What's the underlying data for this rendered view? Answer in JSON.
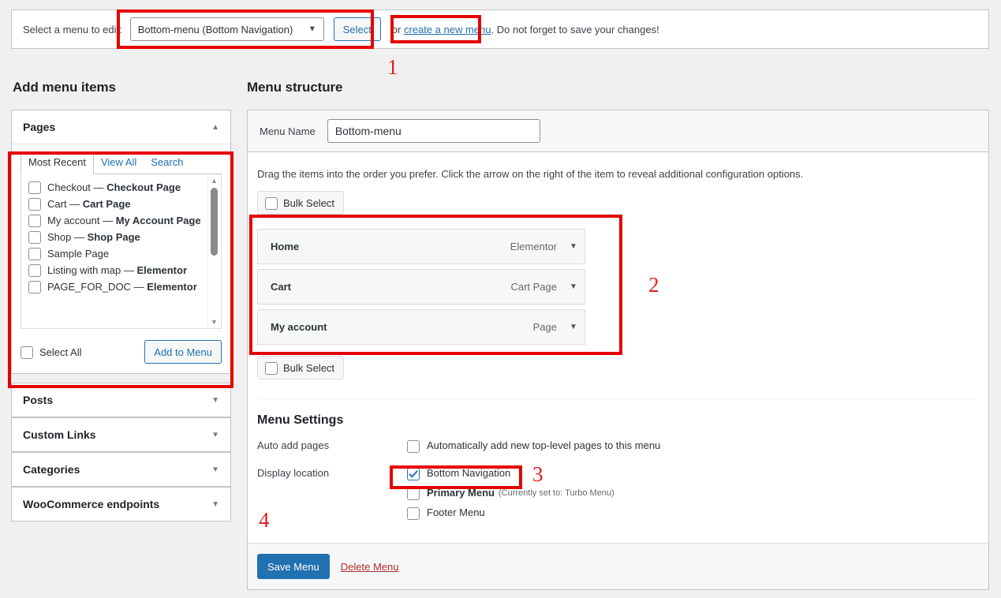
{
  "topbar": {
    "label": "Select a menu to edit:",
    "selected_menu": "Bottom-menu (Bottom Navigation)",
    "select_button": "Select",
    "or_text": "or",
    "create_link": "create a new menu",
    "tail_text": ". Do not forget to save your changes!"
  },
  "left": {
    "heading": "Add menu items",
    "pages_panel": {
      "title": "Pages",
      "tabs": [
        {
          "label": "Most Recent",
          "active": true
        },
        {
          "label": "View All",
          "active": false
        },
        {
          "label": "Search",
          "active": false
        }
      ],
      "rows": [
        {
          "kind": "check",
          "plain": "Checkout — ",
          "bold": "Checkout Page"
        },
        {
          "kind": "check",
          "plain": "Cart — ",
          "bold": "Cart Page"
        },
        {
          "kind": "check",
          "plain": "My account — ",
          "bold": "My Account Page"
        },
        {
          "kind": "check",
          "plain": "Shop — ",
          "bold": "Shop Page"
        },
        {
          "kind": "check",
          "plain": "Sample Page",
          "bold": ""
        },
        {
          "kind": "check",
          "plain": "Listing with map — ",
          "bold": "Elementor"
        },
        {
          "kind": "check",
          "plain": "PAGE_FOR_DOC — ",
          "bold": "Elementor"
        }
      ],
      "select_all": "Select All",
      "add_button": "Add to Menu"
    },
    "other_panels": [
      {
        "title": "Posts"
      },
      {
        "title": "Custom Links"
      },
      {
        "title": "Categories"
      },
      {
        "title": "WooCommerce endpoints"
      }
    ]
  },
  "right": {
    "heading": "Menu structure",
    "menu_name_label": "Menu Name",
    "menu_name_value": "Bottom-menu",
    "menu_name_placeholder": "Menu Name",
    "hint": "Drag the items into the order you prefer. Click the arrow on the right of the item to reveal additional configuration options.",
    "bulk_select_top": "Bulk Select",
    "bulk_select_bottom": "Bulk Select",
    "items": [
      {
        "title": "Home",
        "type": "Elementor"
      },
      {
        "title": "Cart",
        "type": "Cart Page"
      },
      {
        "title": "My account",
        "type": "Page"
      }
    ],
    "settings": {
      "title": "Menu Settings",
      "auto_add_label": "Auto add pages",
      "auto_add_option": "Automatically add new top-level pages to this menu",
      "auto_add_checked": false,
      "display_location_label": "Display location",
      "locations": [
        {
          "label": "Bottom Navigation",
          "note": "",
          "checked": true
        },
        {
          "label": "Primary Menu",
          "note": "(Currently set to: Turbo Menu)",
          "checked": false
        },
        {
          "label": "Footer Menu",
          "note": "",
          "checked": false
        }
      ]
    },
    "save_button": "Save Menu",
    "delete_link": "Delete Menu"
  },
  "annotations": [
    {
      "number": "1"
    },
    {
      "number": "2"
    },
    {
      "number": "3"
    },
    {
      "number": "4"
    }
  ],
  "colors": {
    "annotation_red": "#e60000",
    "accent_blue": "#2271b1",
    "page_bg": "#f0f0f1"
  }
}
